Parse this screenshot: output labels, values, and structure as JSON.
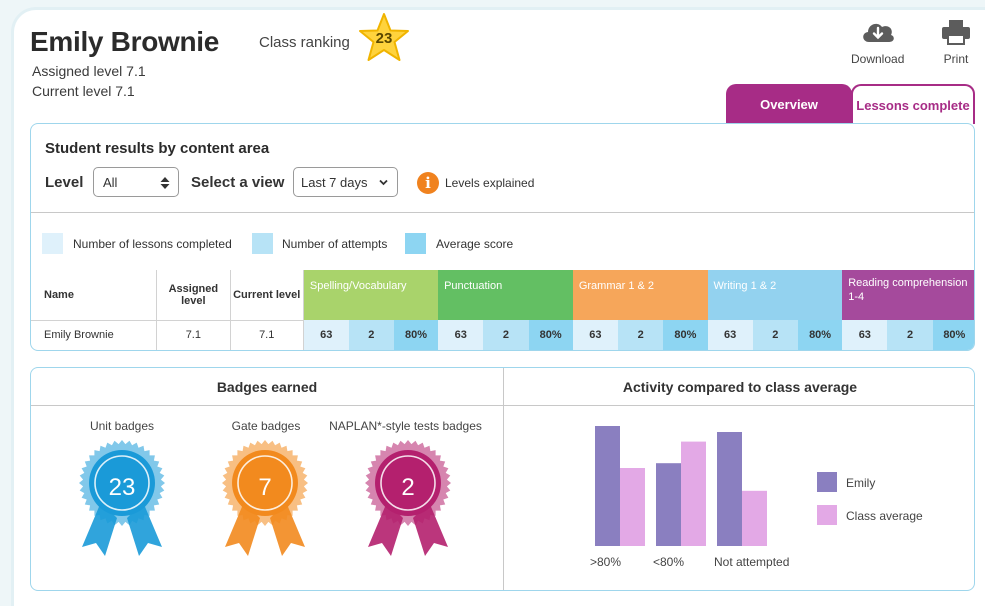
{
  "student": {
    "name": "Emily Brownie",
    "assigned_level": "Assigned level 7.1",
    "current_level": "Current level 7.1",
    "ranking_label": "Class ranking",
    "ranking_value": "23"
  },
  "toolbar": {
    "download_label": "Download",
    "print_label": "Print"
  },
  "tabs": [
    {
      "label": "Overview"
    },
    {
      "label": "Lessons complete"
    }
  ],
  "results": {
    "title": "Student results by content area",
    "level_label": "Level",
    "level_value": "All",
    "view_label": "Select a view",
    "view_value": "Last 7 days",
    "info_label": "Levels explained",
    "legend": [
      {
        "label": "Number of lessons completed",
        "color": "#dff1fb"
      },
      {
        "label": "Number of attempts",
        "color": "#b7e3f6"
      },
      {
        "label": "Average score",
        "color": "#8dd5f2"
      }
    ],
    "columns": {
      "name": "Name",
      "assigned": "Assigned level",
      "current": "Current level"
    },
    "areas": [
      {
        "label": "Spelling/Vocabulary",
        "color": "#a9d36b"
      },
      {
        "label": "Punctuation",
        "color": "#63bf63"
      },
      {
        "label": "Grammar 1 & 2",
        "color": "#f6a65a"
      },
      {
        "label": "Writing 1 & 2",
        "color": "#93d2ef"
      },
      {
        "label": "Reading comprehension 1-4",
        "color": "#a54a9c"
      }
    ],
    "row": {
      "name": "Emily Brownie",
      "assigned": "7.1",
      "current": "7.1",
      "values": [
        [
          "63",
          "2",
          "80%"
        ],
        [
          "63",
          "2",
          "80%"
        ],
        [
          "63",
          "2",
          "80%"
        ],
        [
          "63",
          "2",
          "80%"
        ],
        [
          "63",
          "2",
          "80%"
        ]
      ]
    }
  },
  "badges": {
    "title": "Badges earned",
    "items": [
      {
        "label": "Unit badges",
        "count": "23",
        "color": "#1a9ad8"
      },
      {
        "label": "Gate badges",
        "count": "7",
        "color": "#f28a1e"
      },
      {
        "label": "NAPLAN*-style tests badges",
        "count": "2",
        "color": "#b4206e"
      }
    ]
  },
  "activity": {
    "title": "Activity compared to class average"
  },
  "chart_data": {
    "type": "bar",
    "categories": [
      ">80%",
      "<80%",
      "Not attempted"
    ],
    "series": [
      {
        "name": "Emily",
        "values": [
          100,
          69,
          95
        ],
        "color": "#8a7fc0"
      },
      {
        "name": "Class average",
        "values": [
          65,
          87,
          46
        ],
        "color": "#e3a9e6"
      }
    ],
    "ylim": [
      0,
      100
    ],
    "grid": false,
    "legend": "right"
  }
}
